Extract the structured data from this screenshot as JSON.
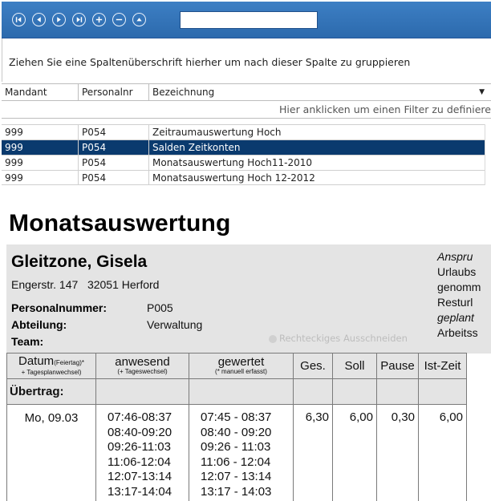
{
  "toolbar": {
    "buttons": [
      {
        "name": "first-record-icon"
      },
      {
        "name": "previous-record-icon"
      },
      {
        "name": "next-record-icon"
      },
      {
        "name": "last-record-icon"
      },
      {
        "name": "add-record-icon"
      },
      {
        "name": "remove-record-icon"
      },
      {
        "name": "collapse-up-icon"
      }
    ],
    "search_value": ""
  },
  "group_area": {
    "hint": "Ziehen Sie eine Spaltenüberschrift hierher um nach dieser Spalte zu gruppieren"
  },
  "grid": {
    "columns": [
      "Mandant",
      "Personalnr",
      "Bezeichnung"
    ],
    "filter_hint": "Hier anklicken um einen Filter zu definieren",
    "rows": [
      {
        "mandant": "999",
        "personalnr": "P054",
        "bezeichnung": "Zeitraumauswertung Hoch",
        "selected": false
      },
      {
        "mandant": "999",
        "personalnr": "P054",
        "bezeichnung": "Salden Zeitkonten",
        "selected": true
      },
      {
        "mandant": "999",
        "personalnr": "P054",
        "bezeichnung": "Monatsauswertung Hoch11-2010",
        "selected": false
      },
      {
        "mandant": "999",
        "personalnr": "P054",
        "bezeichnung": "Monatsauswertung Hoch 12-2012",
        "selected": false
      }
    ],
    "selected_color": "#0a3a6e"
  },
  "report": {
    "title": "Monatsauswertung",
    "employee_name": "Gleitzone, Gisela",
    "address": "Engerstr. 147   32051 Herford",
    "personalnummer_label": "Personalnummer:",
    "personalnummer_value": "P005",
    "abteilung_label": "Abteilung:",
    "abteilung_value": "Verwaltung",
    "team_label": "Team:",
    "team_value": "",
    "right_col": [
      "Anspru",
      "Urlaubs",
      "genomm",
      "Resturl",
      "geplant",
      "Arbeitss"
    ],
    "ghost_label": "Rechteckiges Ausschneiden",
    "table": {
      "headers": [
        {
          "main": "Datum",
          "main_small": "(Feiertag)*",
          "sub": "+ Tagesplanwechsel)"
        },
        {
          "main": "anwesend",
          "sub": "(+ Tageswechsel)"
        },
        {
          "main": "gewertet",
          "sub": "(* manuell erfasst)"
        },
        {
          "main": "Ges."
        },
        {
          "main": "Soll"
        },
        {
          "main": "Pause"
        },
        {
          "main": "Ist-Zeit"
        }
      ],
      "uebertrag_label": "Übertrag:",
      "day": {
        "date": "Mo, 09.03",
        "anwesend": [
          "07:46-08:37",
          "08:40-09:20",
          "09:26-11:03",
          "11:06-12:04",
          "12:07-13:14",
          "13:17-14:04"
        ],
        "gewertet": [
          "07:45 - 08:37",
          "08:40 - 09:20",
          "09:26 - 11:03",
          "11:06 - 12:04",
          "12:07 - 13:14",
          "13:17 - 14:03"
        ],
        "ges": "6,30",
        "soll": "6,00",
        "pause": "0,30",
        "ist": "6,00"
      }
    }
  }
}
